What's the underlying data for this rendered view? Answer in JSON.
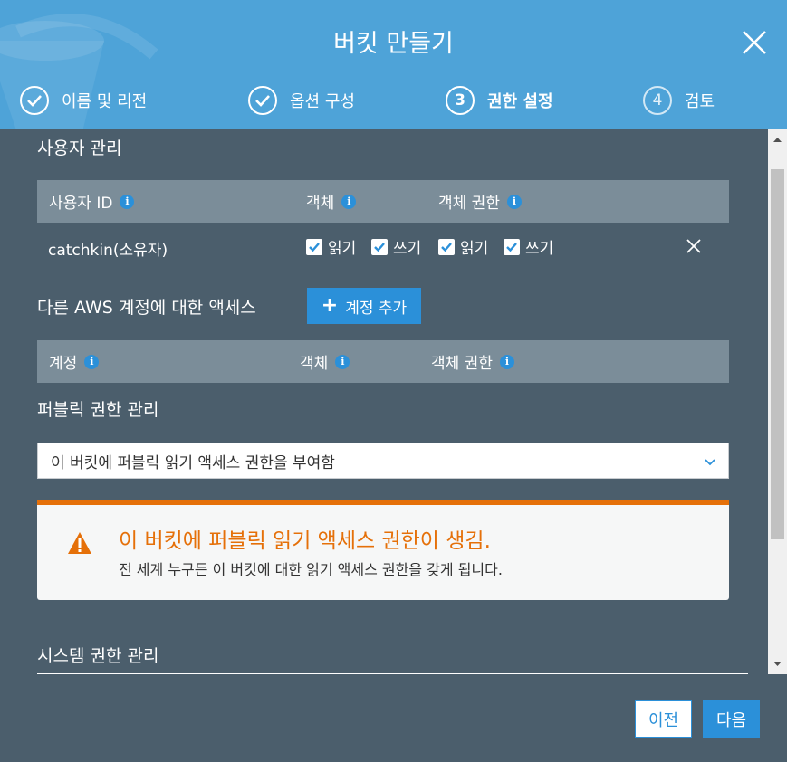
{
  "header": {
    "title": "버킷 만들기",
    "steps": [
      {
        "number": "1",
        "label": "이름 및 리전",
        "state": "done"
      },
      {
        "number": "2",
        "label": "옵션 구성",
        "state": "done"
      },
      {
        "number": "3",
        "label": "권한 설정",
        "state": "active"
      },
      {
        "number": "4",
        "label": "검토",
        "state": "pending"
      }
    ]
  },
  "user_management": {
    "title": "사용자 관리",
    "columns": {
      "user_id": "사용자 ID",
      "objects": "객체",
      "object_permissions": "객체 권한"
    },
    "rows": [
      {
        "user": "catchkin(소유자)",
        "objects_read": "읽기",
        "objects_write": "쓰기",
        "perm_read": "읽기",
        "perm_write": "쓰기"
      }
    ]
  },
  "other_accounts": {
    "title": "다른 AWS 계정에 대한 액세스",
    "add_button": "계정 추가",
    "columns": {
      "account": "계정",
      "objects": "객체",
      "object_permissions": "객체 권한"
    }
  },
  "public_permissions": {
    "title": "퍼블릭 권한 관리",
    "selected": "이 버킷에 퍼블릭 읽기 액세스 권한을 부여함",
    "alert_title": "이 버킷에 퍼블릭 읽기 액세스 권한이 생김.",
    "alert_message": "전 세계 누구든 이 버킷에 대한 읽기 액세스 권한을 갖게 됩니다."
  },
  "system_permissions": {
    "title": "시스템 권한 관리"
  },
  "footer": {
    "prev_label": "이전",
    "next_label": "다음"
  },
  "colors": {
    "header": "#4ea3d8",
    "body": "#4b5e6c",
    "accent": "#2b90d9",
    "warning": "#e57009",
    "table_header": "#7b8d99"
  }
}
